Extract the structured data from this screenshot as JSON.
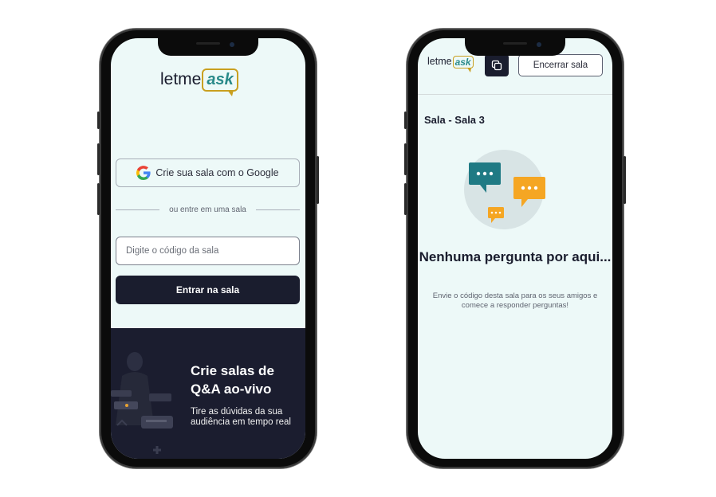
{
  "login": {
    "logo": {
      "word1": "letme",
      "word2": "ask"
    },
    "google_button": "Crie sua sala com o Google",
    "divider": "ou entre em uma sala",
    "room_code_placeholder": "Digite o código da sala",
    "enter_button": "Entrar na sala",
    "hero": {
      "title": "Crie salas de Q&A ao-vivo",
      "subtitle": "Tire as dúvidas da sua audiência em tempo real"
    }
  },
  "room": {
    "logo": {
      "word1": "letme",
      "word2": "ask"
    },
    "copy_icon": "copy-icon",
    "close_button": "Encerrar sala",
    "title": "Sala - Sala 3",
    "empty_title": "Nenhuma pergunta por aqui...",
    "empty_description": "Envie o código desta sala para os seus amigos e comece a responder perguntas!"
  },
  "colors": {
    "background": "#edf9f8",
    "dark": "#1a1d2e",
    "teal": "#2a8a8a",
    "gold": "#c9a020",
    "orange": "#f5a623"
  }
}
